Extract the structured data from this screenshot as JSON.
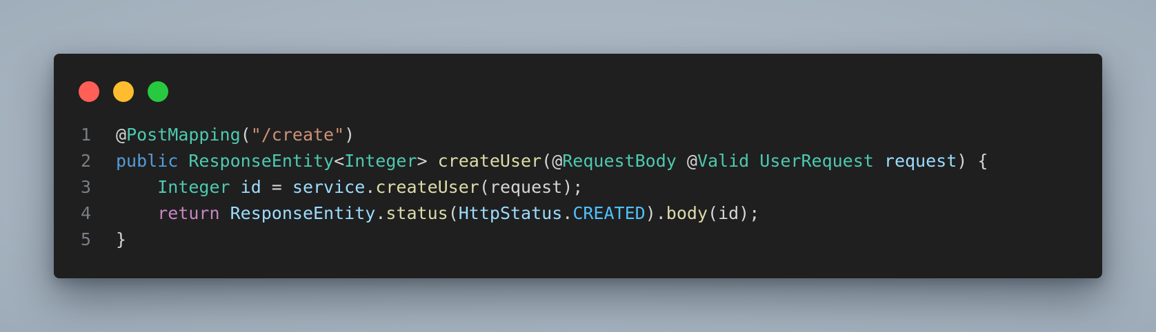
{
  "window": {
    "traffic_lights": [
      {
        "name": "close",
        "color": "#ff5f57"
      },
      {
        "name": "minimize",
        "color": "#febc2e"
      },
      {
        "name": "maximize",
        "color": "#28c840"
      }
    ]
  },
  "code": {
    "lines": [
      {
        "number": "1",
        "tokens": [
          {
            "t": "@",
            "k": "plain"
          },
          {
            "t": "PostMapping",
            "k": "type"
          },
          {
            "t": "(",
            "k": "plain"
          },
          {
            "t": "\"/create\"",
            "k": "str"
          },
          {
            "t": ")",
            "k": "plain"
          }
        ]
      },
      {
        "number": "2",
        "tokens": [
          {
            "t": "public",
            "k": "kw"
          },
          {
            "t": " ",
            "k": "plain"
          },
          {
            "t": "ResponseEntity",
            "k": "type"
          },
          {
            "t": "<",
            "k": "plain"
          },
          {
            "t": "Integer",
            "k": "type"
          },
          {
            "t": "> ",
            "k": "plain"
          },
          {
            "t": "createUser",
            "k": "fn"
          },
          {
            "t": "(@",
            "k": "plain"
          },
          {
            "t": "RequestBody",
            "k": "type"
          },
          {
            "t": " @",
            "k": "plain"
          },
          {
            "t": "Valid",
            "k": "type"
          },
          {
            "t": " ",
            "k": "plain"
          },
          {
            "t": "UserRequest",
            "k": "type"
          },
          {
            "t": " ",
            "k": "plain"
          },
          {
            "t": "request",
            "k": "var"
          },
          {
            "t": ") {",
            "k": "plain"
          }
        ]
      },
      {
        "number": "3",
        "tokens": [
          {
            "t": "    ",
            "k": "plain"
          },
          {
            "t": "Integer",
            "k": "type"
          },
          {
            "t": " ",
            "k": "plain"
          },
          {
            "t": "id",
            "k": "var"
          },
          {
            "t": " = ",
            "k": "plain"
          },
          {
            "t": "service",
            "k": "var"
          },
          {
            "t": ".",
            "k": "plain"
          },
          {
            "t": "createUser",
            "k": "fn"
          },
          {
            "t": "(request);",
            "k": "plain"
          }
        ]
      },
      {
        "number": "4",
        "tokens": [
          {
            "t": "    ",
            "k": "plain"
          },
          {
            "t": "return",
            "k": "ctrl"
          },
          {
            "t": " ",
            "k": "plain"
          },
          {
            "t": "ResponseEntity",
            "k": "var"
          },
          {
            "t": ".",
            "k": "plain"
          },
          {
            "t": "status",
            "k": "fn"
          },
          {
            "t": "(",
            "k": "plain"
          },
          {
            "t": "HttpStatus",
            "k": "var"
          },
          {
            "t": ".",
            "k": "plain"
          },
          {
            "t": "CREATED",
            "k": "var-const"
          },
          {
            "t": ").",
            "k": "plain"
          },
          {
            "t": "body",
            "k": "fn"
          },
          {
            "t": "(id);",
            "k": "plain"
          }
        ]
      },
      {
        "number": "5",
        "tokens": [
          {
            "t": "}",
            "k": "plain"
          }
        ]
      }
    ]
  }
}
